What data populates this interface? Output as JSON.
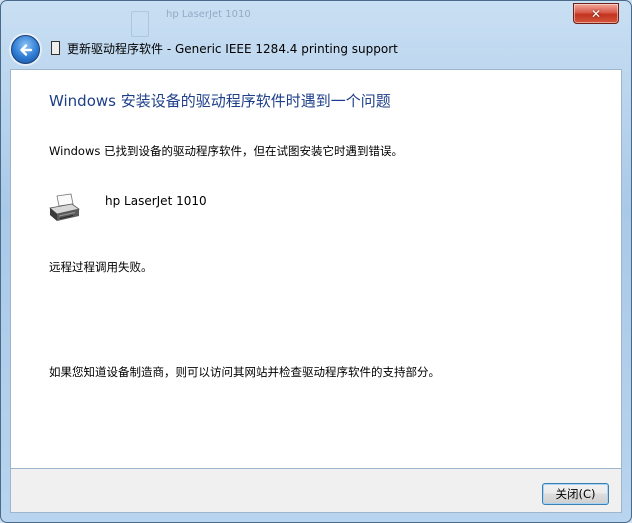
{
  "window": {
    "title": "更新驱动程序软件 - Generic IEEE 1284.4 printing support",
    "background_ghost_text": "hp LaserJet 1010",
    "close_glyph": "✕"
  },
  "content": {
    "heading": "Windows 安装设备的驱动程序软件时遇到一个问题",
    "found_message": "Windows 已找到设备的驱动程序软件，但在试图安装它时遇到错误。",
    "device_name": "hp LaserJet 1010",
    "error_message": "远程过程调用失败。",
    "help_message": "如果您知道设备制造商，则可以访问其网站并检查驱动程序软件的支持部分。"
  },
  "footer": {
    "close_button_label": "关闭(C)"
  },
  "colors": {
    "heading": "#1e3f8a",
    "accent": "#2d7bd4"
  },
  "icons": [
    "back-arrow-icon",
    "printer-icon",
    "close-icon"
  ]
}
